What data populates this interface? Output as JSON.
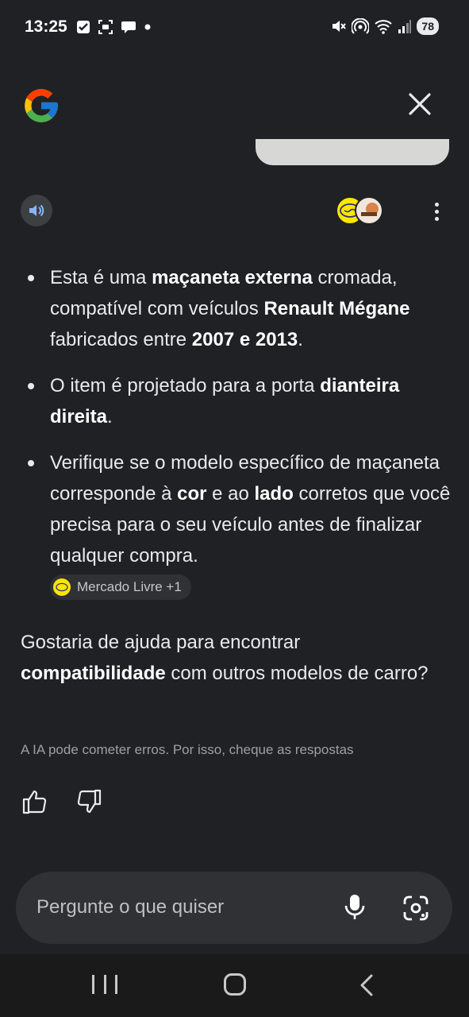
{
  "status_bar": {
    "time": "13:25",
    "battery": "78",
    "left_icons": [
      "checkbox-icon",
      "screenshot-icon",
      "chat-bubble-icon",
      "dot-icon"
    ],
    "right_icons": [
      "mute-icon",
      "hotspot-icon",
      "wifi-icon",
      "signal-icon"
    ]
  },
  "header": {
    "logo": "google-g-logo",
    "close_icon": "close-icon"
  },
  "answer": {
    "bullets": [
      {
        "parts": [
          {
            "t": "Esta é uma ",
            "b": false
          },
          {
            "t": "maçaneta externa",
            "b": true
          },
          {
            "t": " cromada, compatível com veículos ",
            "b": false
          },
          {
            "t": "Renault Mégane",
            "b": true
          },
          {
            "t": " fabricados entre ",
            "b": false
          },
          {
            "t": "2007 e 2013",
            "b": true
          },
          {
            "t": ".",
            "b": false
          }
        ]
      },
      {
        "parts": [
          {
            "t": "O item é projetado para a porta ",
            "b": false
          },
          {
            "t": "dianteira direita",
            "b": true
          },
          {
            "t": ".",
            "b": false
          }
        ]
      },
      {
        "parts": [
          {
            "t": "Verifique se o modelo específico de maçaneta corresponde à ",
            "b": false
          },
          {
            "t": "cor",
            "b": true
          },
          {
            "t": " e ao ",
            "b": false
          },
          {
            "t": "lado",
            "b": true
          },
          {
            "t": " corretos que você precisa para o seu veículo antes de finalizar qualquer compra.",
            "b": false
          }
        ]
      }
    ],
    "source_chip": "Mercado Livre +1"
  },
  "followup": {
    "parts": [
      {
        "t": "Gostaria de ajuda para encontrar ",
        "b": false
      },
      {
        "t": "compatibilidade",
        "b": true
      },
      {
        "t": " com outros modelos de carro?",
        "b": false
      }
    ]
  },
  "disclaimer": "A IA pode cometer erros. Por isso, cheque as respostas",
  "input": {
    "placeholder": "Pergunte o que quiser"
  },
  "colors": {
    "background": "#202124",
    "surface": "#303134",
    "text": "#e8eaed",
    "muted": "#9aa0a6"
  }
}
